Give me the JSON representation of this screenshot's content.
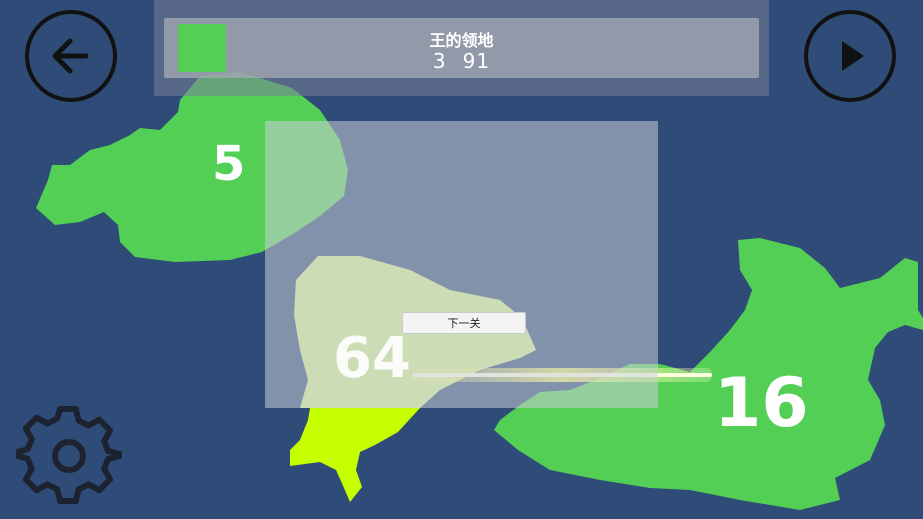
{
  "header": {
    "title": "王的领地",
    "stat_left": "3",
    "stat_right": "91",
    "swatch_color": "#52cf54"
  },
  "dialog": {
    "next_label": "下一关"
  },
  "regions": [
    {
      "id": "west",
      "count": "5",
      "color": "#52cf54"
    },
    {
      "id": "center",
      "count": "64",
      "color": "#d1ef8c"
    },
    {
      "id": "south-tip",
      "count": "",
      "color": "#c5ff00"
    },
    {
      "id": "east",
      "count": "16",
      "color": "#52cf54"
    }
  ],
  "icons": {
    "back": "arrow-left-icon",
    "play": "play-icon",
    "settings": "gear-icon"
  }
}
